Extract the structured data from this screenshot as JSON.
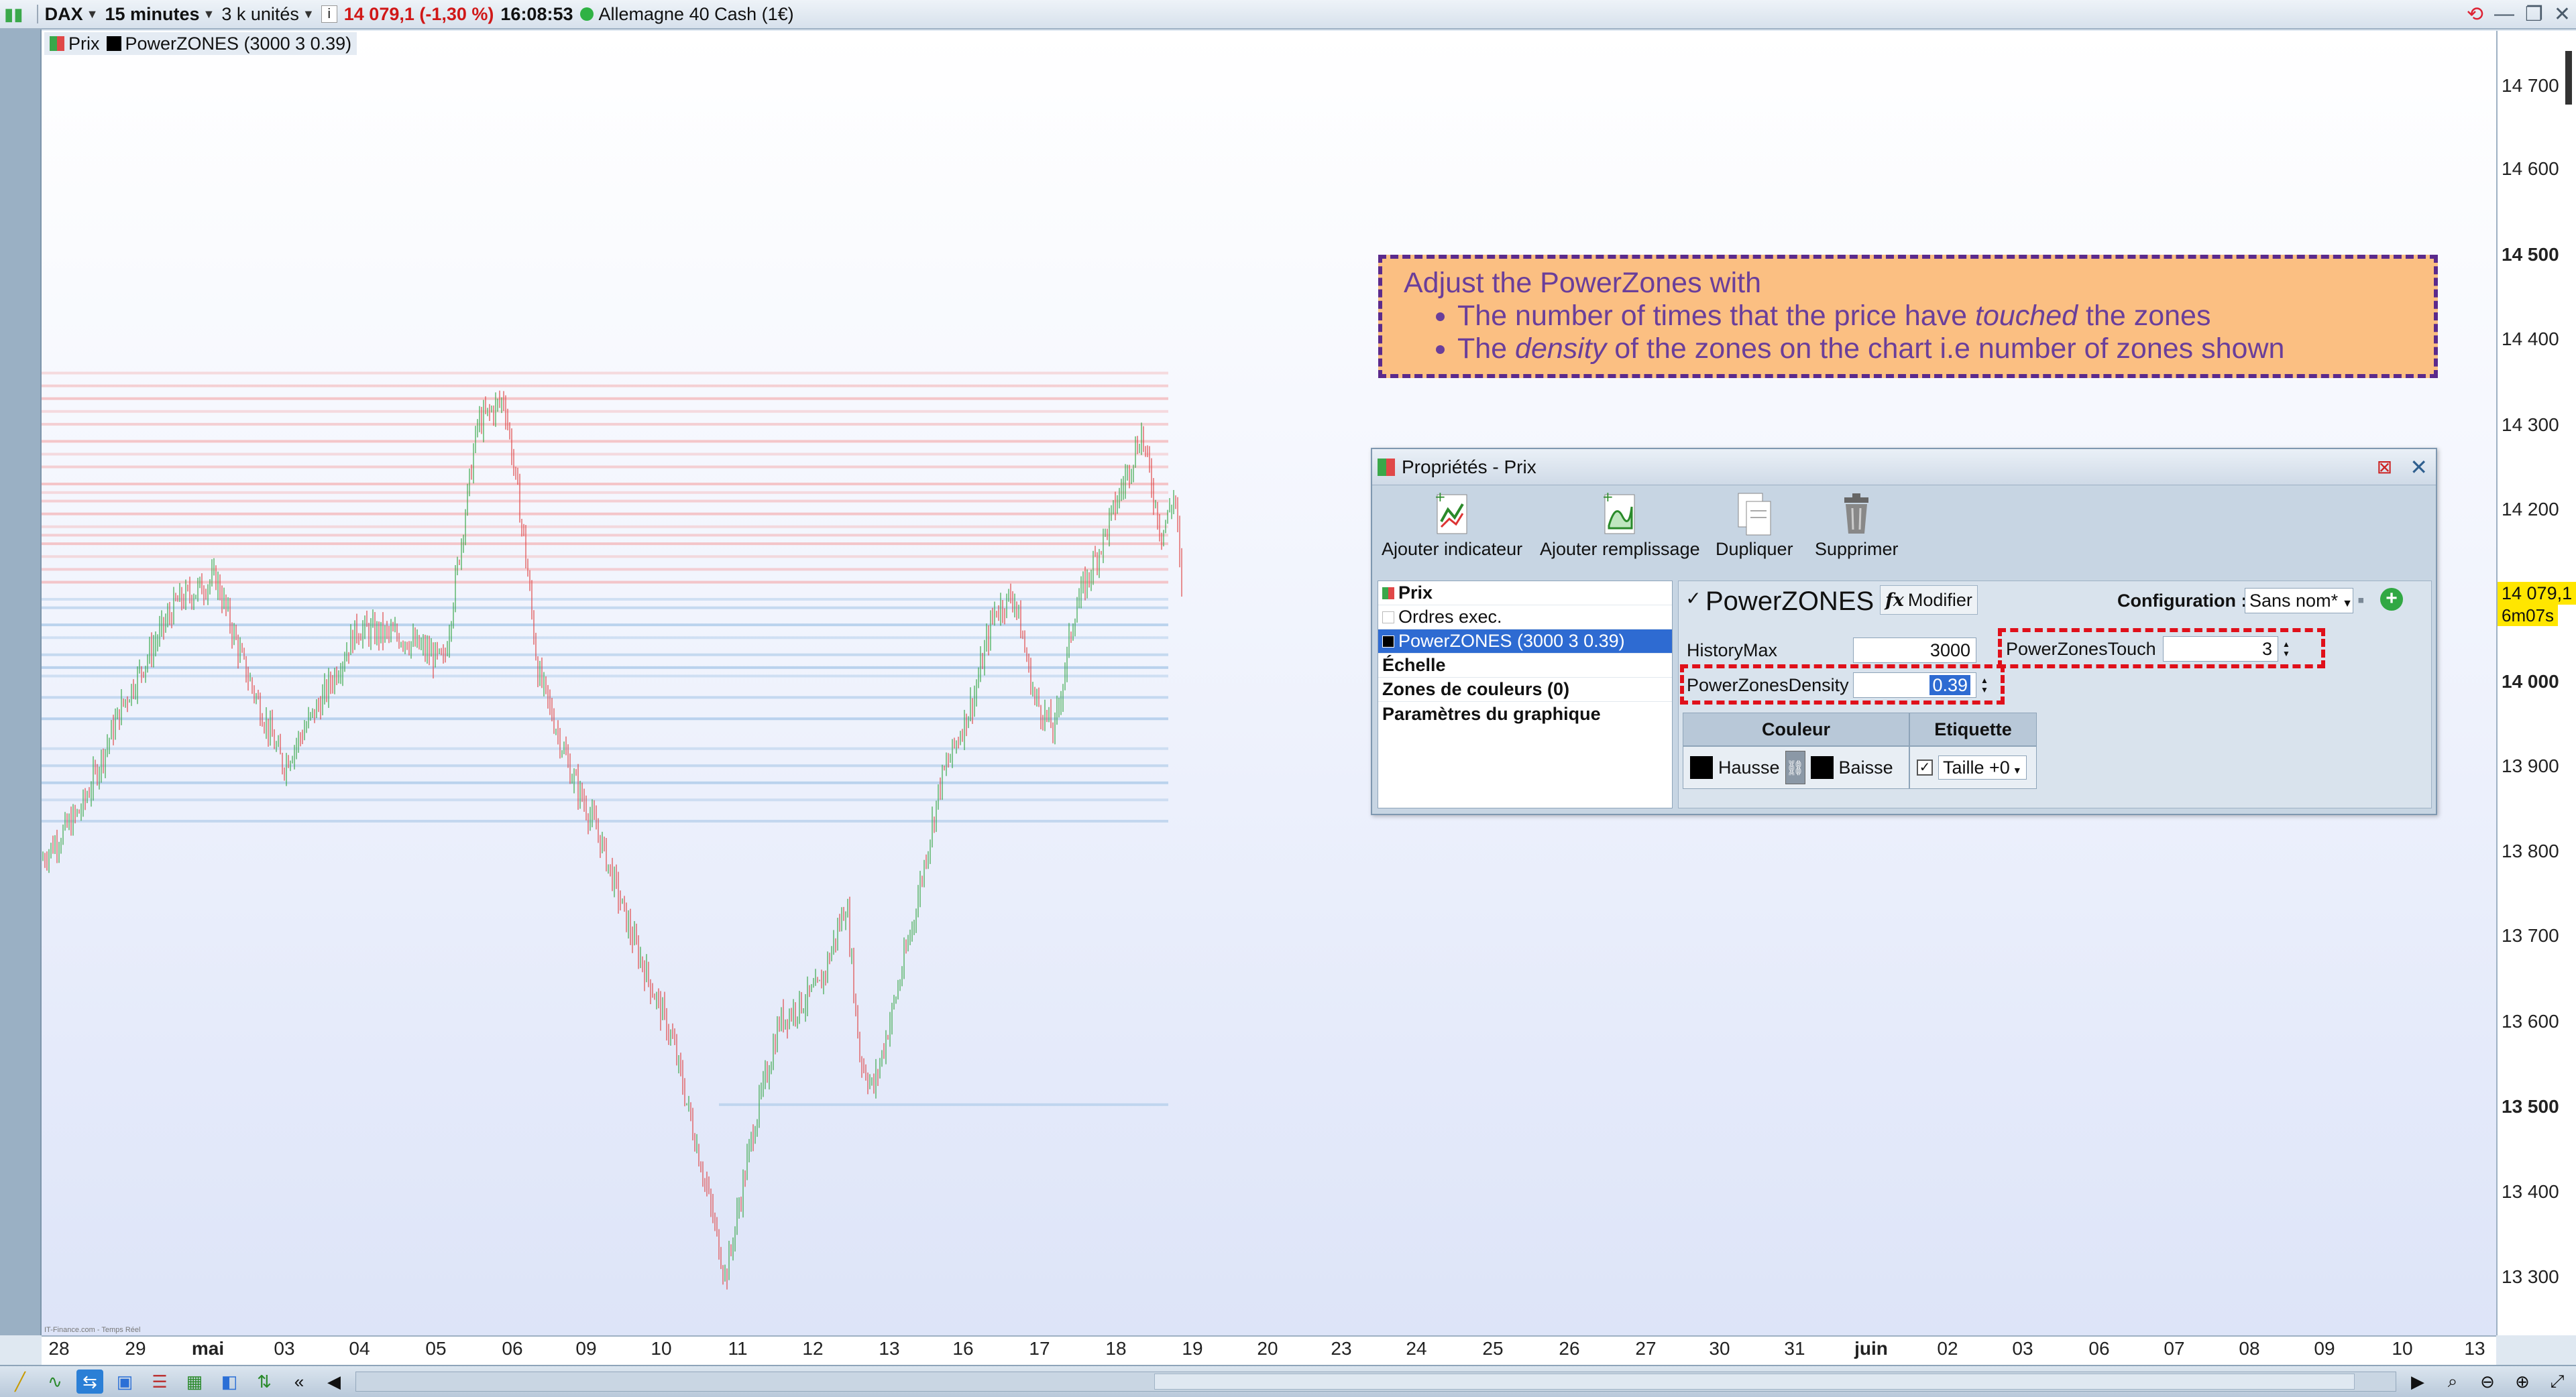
{
  "topbar": {
    "instrument": "DAX",
    "timeframe": "15 minutes",
    "units": "3 k unités",
    "price_change": "14 079,1 (-1,30 %)",
    "time": "16:08:53",
    "market": "Allemagne 40 Cash (1€)"
  },
  "legend": {
    "price": "Prix",
    "indicator": "PowerZONES (3000 3 0.39)"
  },
  "yaxis": {
    "ticks": [
      "14 700",
      "14 600",
      "14 500",
      "14 400",
      "14 300",
      "14 200",
      "14 100",
      "14 000",
      "13 900",
      "13 800",
      "13 700",
      "13 600",
      "13 500",
      "13 400",
      "13 300"
    ],
    "current_price": "14 079,1",
    "countdown": "6m07s"
  },
  "xaxis": {
    "ticks": [
      "28",
      "29",
      "mai",
      "03",
      "04",
      "05",
      "06",
      "09",
      "10",
      "11",
      "12",
      "13",
      "16",
      "17",
      "18",
      "19",
      "20",
      "23",
      "24",
      "25",
      "26",
      "27",
      "30",
      "31",
      "juin",
      "02",
      "03",
      "06",
      "07",
      "08",
      "09",
      "10",
      "13"
    ]
  },
  "watermark": "IT-Finance.com - Temps Réel",
  "annotation": {
    "line1": "Adjust the PowerZones with",
    "b1_pre": "The number of times that the price have ",
    "b1_em": "touched",
    "b1_post": " the zones",
    "b2_pre": "The ",
    "b2_em": "density",
    "b2_post": " of the zones on the chart i.e number of zones shown"
  },
  "dialog": {
    "title": "Propriétés - Prix",
    "tools": [
      "Ajouter indicateur",
      "Ajouter remplissage",
      "Dupliquer",
      "Supprimer"
    ],
    "list": [
      "Prix",
      "Ordres exec.",
      "PowerZONES (3000 3 0.39)",
      "Échelle",
      "Zones de couleurs (0)",
      "Paramètres du graphique"
    ],
    "indicator_name": "PowerZONES",
    "modify_label": "Modifier",
    "config_label": "Configuration :",
    "config_value": "Sans nom*",
    "history_label": "HistoryMax",
    "history_value": "3000",
    "touch_label": "PowerZonesTouch",
    "touch_value": "3",
    "density_label": "PowerZonesDensity",
    "density_value": "0.39",
    "col_couleur": "Couleur",
    "col_etiquette": "Etiquette",
    "hausse": "Hausse",
    "baisse": "Baisse",
    "taille": "Taille +0"
  },
  "colors": {
    "up": "#3aa84a",
    "down": "#e04848",
    "resistance_zone": "#f4b5b8",
    "support_zone": "#a9c8e8",
    "annotation_bg": "#fbbf82",
    "annotation_border": "#5b2a8c",
    "highlight": "#e0101a"
  }
}
